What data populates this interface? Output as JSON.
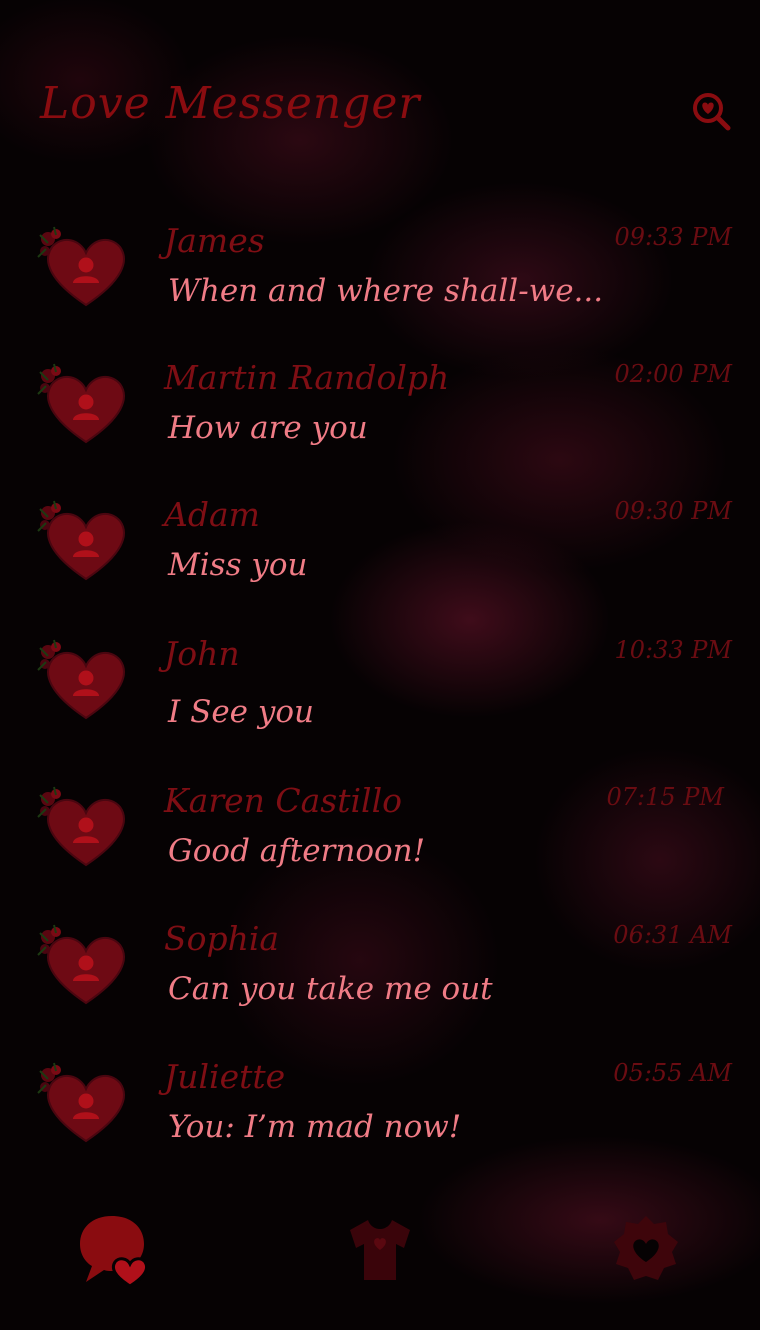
{
  "header": {
    "title": "Love Messenger",
    "search_icon": "search-heart-icon"
  },
  "colors": {
    "title": "#8a0c10",
    "name": "#7e0e14",
    "time": "#6a0c12",
    "preview": "#f07c86",
    "heart": "#6e0a14",
    "background": "#060203"
  },
  "conversations": [
    {
      "name": "James",
      "time": "09:33 PM",
      "preview": "When and where shall-we..."
    },
    {
      "name": "Martin Randolph",
      "time": "02:00 PM",
      "preview": "How are you"
    },
    {
      "name": "Adam",
      "time": "09:30 PM",
      "preview": "Miss you"
    },
    {
      "name": "John",
      "time": "10:33 PM",
      "preview": "I See you"
    },
    {
      "name": "Karen Castillo",
      "time": "07:15 PM",
      "preview": "Good afternoon!"
    },
    {
      "name": "Sophia",
      "time": "06:31 AM",
      "preview": "Can you take me out"
    },
    {
      "name": "Juliette",
      "time": "05:55 AM",
      "preview": "You: I’m mad now!"
    }
  ],
  "bottom_nav": {
    "items": [
      {
        "icon": "chat-heart-icon",
        "active": true
      },
      {
        "icon": "theme-shirt-icon",
        "active": false
      },
      {
        "icon": "settings-heart-icon",
        "active": false
      }
    ]
  }
}
